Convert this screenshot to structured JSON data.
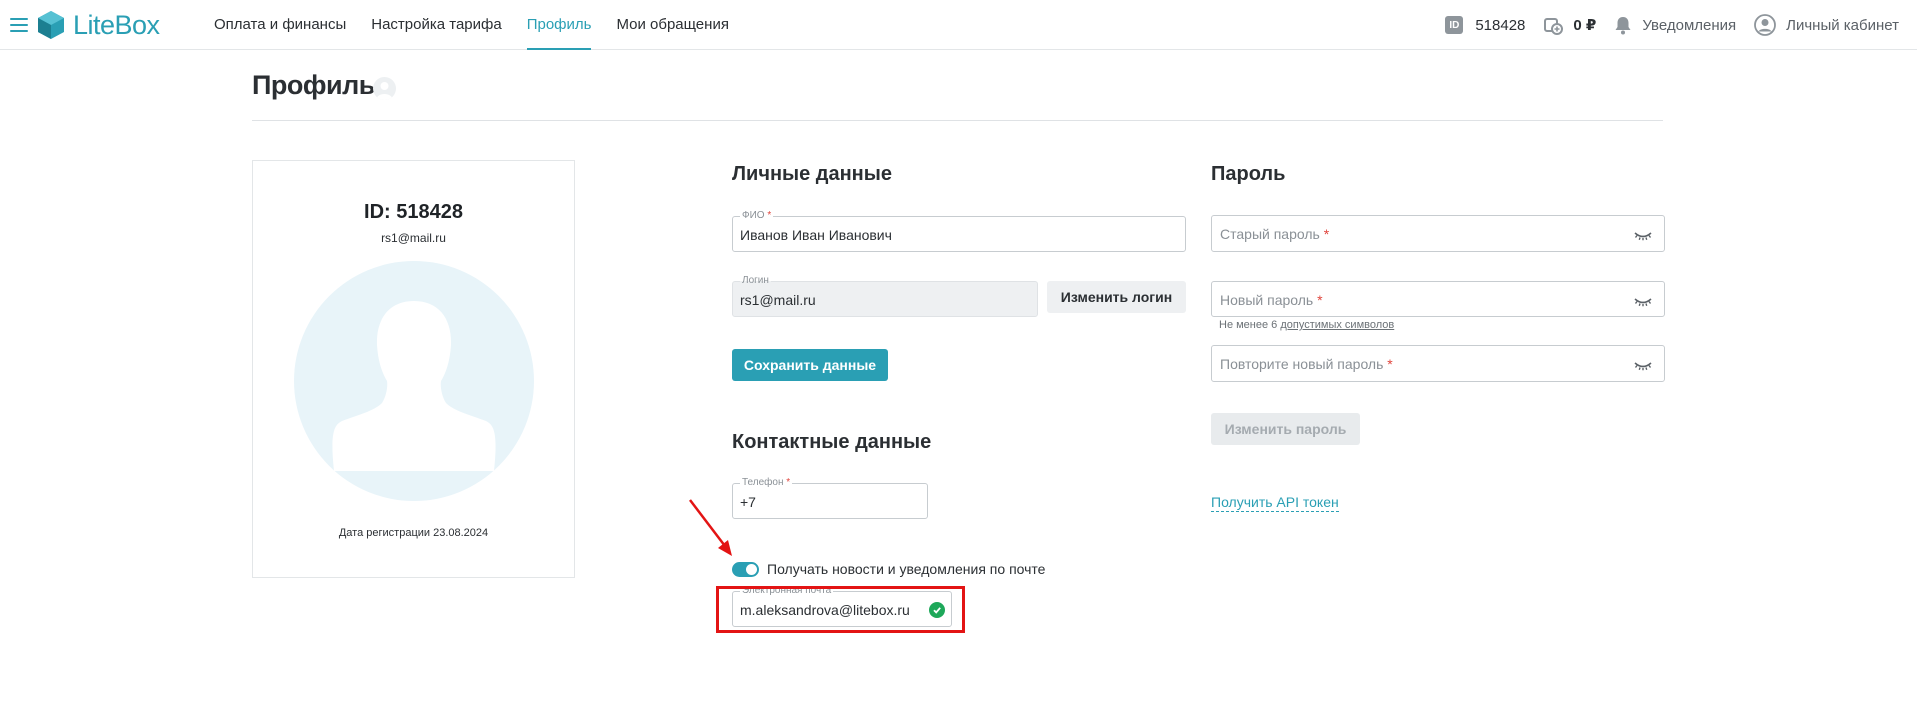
{
  "header": {
    "logo_text": "LiteBox",
    "nav": [
      {
        "label": "Оплата и финансы"
      },
      {
        "label": "Настройка тарифа"
      },
      {
        "label": "Профиль"
      },
      {
        "label": "Мои обращения"
      }
    ],
    "id_badge": "ID",
    "account_id": "518428",
    "balance": "0 ₽",
    "notifications_label": "Уведомления",
    "cabinet_label": "Личный кабинет"
  },
  "page": {
    "title": "Профиль"
  },
  "profile_card": {
    "id_text": "ID: 518428",
    "email": "rs1@mail.ru",
    "reg_date": "Дата регистрации 23.08.2024"
  },
  "personal": {
    "title": "Личные данные",
    "fio_label": "ФИО",
    "fio_value": "Иванов Иван Иванович",
    "login_label": "Логин",
    "login_value": "rs1@mail.ru",
    "change_login_button": "Изменить логин",
    "save_button": "Сохранить данные"
  },
  "contacts": {
    "title": "Контактные данные",
    "phone_label": "Телефон",
    "phone_value": "+7",
    "news_toggle_label": "Получать новости и уведомления по почте",
    "email_label": "Электронная почта",
    "email_value": "m.aleksandrova@litebox.ru"
  },
  "password": {
    "title": "Пароль",
    "old_placeholder": "Старый пароль",
    "new_placeholder": "Новый пароль",
    "hint_prefix": "Не менее 6",
    "hint_link": "допустимых символов",
    "repeat_placeholder": "Повторите новый пароль",
    "change_button": "Изменить пароль",
    "api_link": "Получить API токен"
  },
  "required_mark": "*",
  "colors": {
    "accent": "#2a9fb4",
    "required": "#e0443c",
    "success": "#1ea85a",
    "annotation": "#e31414"
  }
}
